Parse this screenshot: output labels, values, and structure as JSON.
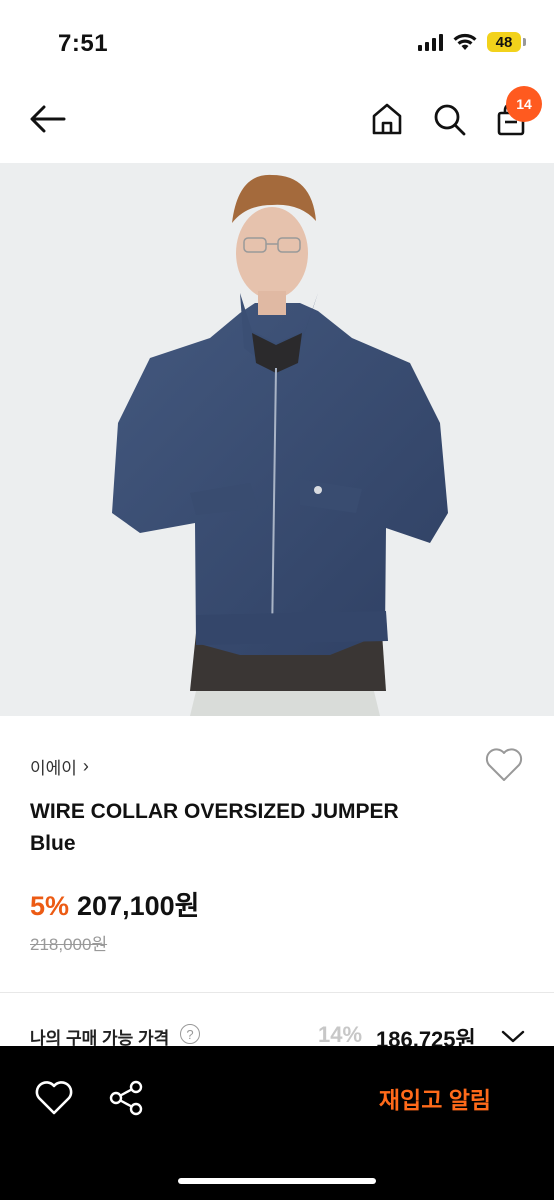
{
  "status_bar": {
    "time": "7:51",
    "battery": "48",
    "icons": [
      "signal-icon",
      "wifi-icon",
      "battery-icon"
    ]
  },
  "nav": {
    "icons": [
      "back-arrow-icon",
      "home-icon",
      "search-icon",
      "shopping-bag-icon"
    ],
    "cart_count": "14",
    "badge_color": "#ff5a1f"
  },
  "product": {
    "image_alt_icon": "product-photo",
    "brand": "이에이",
    "brand_chevron": "›",
    "name": "WIRE COLLAR OVERSIZED JUMPER",
    "variant": "Blue",
    "discount": "5%",
    "price": "207,100원",
    "original_price": "218,000원",
    "accent_color": "#ec5b14"
  },
  "my_price": {
    "label": "나의 구매 가능 가격",
    "help": "?",
    "discount": "14%",
    "price": "186,725원"
  },
  "bottom_bar": {
    "icons": [
      "heart-icon",
      "share-icon"
    ],
    "restock_label": "재입고 알림",
    "restock_color": "#ff6a1a"
  }
}
